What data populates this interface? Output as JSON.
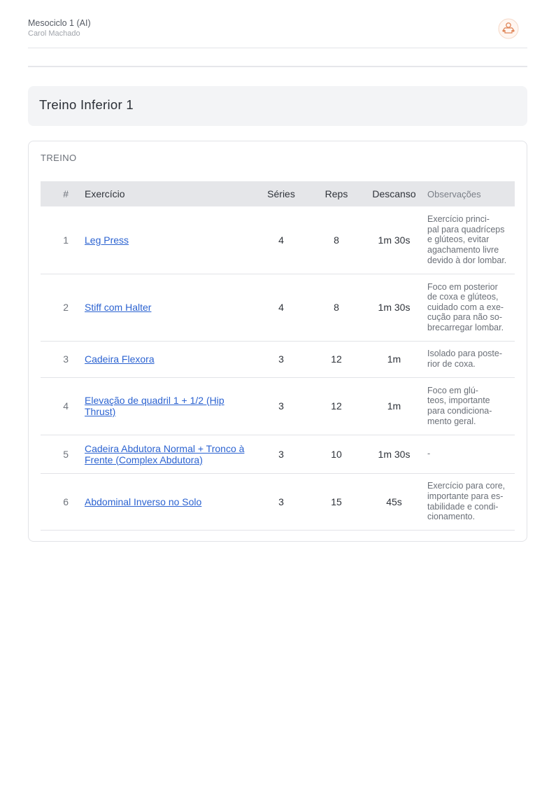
{
  "header": {
    "title": "Mesociclo 1 (AI)",
    "subtitle": "Carol Machado",
    "logo_icon": "bodybuilder-logo-icon"
  },
  "workout": {
    "name": "Treino Inferior 1"
  },
  "section": {
    "label": "TREINO"
  },
  "table": {
    "headers": {
      "num": "#",
      "exercise": "Exercício",
      "sets": "Séries",
      "reps": "Reps",
      "rest": "Descanso",
      "notes": "Observações"
    },
    "rows": [
      {
        "num": "1",
        "exercise": "Leg Press",
        "sets": "4",
        "reps": "8",
        "rest": "1m 30s",
        "notes": "Exercício princi-\npal para quadríceps\ne glúteos, evitar\nagachamento livre\ndevido à dor lombar."
      },
      {
        "num": "2",
        "exercise": "Stiff com Halter",
        "sets": "4",
        "reps": "8",
        "rest": "1m 30s",
        "notes": "Foco em posterior\nde coxa e glúteos,\ncuidado com a exe-\ncução para não so-\nbrecarregar lombar."
      },
      {
        "num": "3",
        "exercise": "Cadeira Flexora",
        "sets": "3",
        "reps": "12",
        "rest": "1m",
        "notes": "Isolado para poste-\nrior de coxa."
      },
      {
        "num": "4",
        "exercise": "Elevação de quadril 1 + 1/2 (Hip Thrust)",
        "sets": "3",
        "reps": "12",
        "rest": "1m",
        "notes": "Foco em glú-\nteos, importante\npara condiciona-\nmento geral."
      },
      {
        "num": "5",
        "exercise": "Cadeira Abdutora Normal + Tronco à Frente (Complex Abdutora)",
        "sets": "3",
        "reps": "10",
        "rest": "1m 30s",
        "notes": "-"
      },
      {
        "num": "6",
        "exercise": "Abdominal Inverso no Solo",
        "sets": "3",
        "reps": "15",
        "rest": "45s",
        "notes": "Exercício para core,\nimportante para es-\ntabilidade e condi-\ncionamento."
      }
    ]
  }
}
